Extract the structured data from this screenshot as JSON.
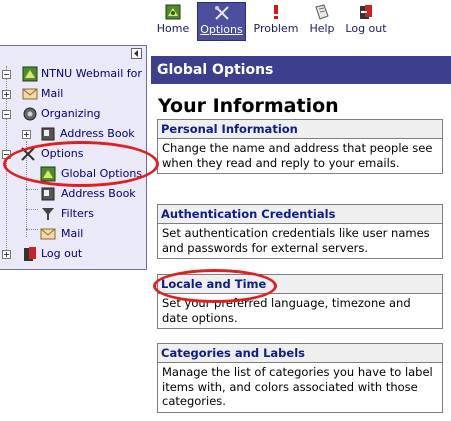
{
  "toolbar": {
    "items": [
      {
        "label": "Home",
        "icon": "home-icon"
      },
      {
        "label": "Options",
        "icon": "options-icon",
        "active": true
      },
      {
        "label": "Problem",
        "icon": "problem-icon"
      },
      {
        "label": "Help",
        "icon": "help-icon"
      },
      {
        "label": "Log out",
        "icon": "logout-icon"
      }
    ]
  },
  "sidebar": {
    "items": [
      {
        "label": "NTNU Webmail for",
        "icon": "webmail-icon"
      },
      {
        "label": "Mail",
        "icon": "mail-icon"
      },
      {
        "label": "Organizing",
        "icon": "organizing-icon"
      },
      {
        "label": "Address Book",
        "icon": "address-book-icon"
      },
      {
        "label": "Options",
        "icon": "options-icon"
      },
      {
        "label": "Global Options",
        "icon": "global-options-icon"
      },
      {
        "label": "Address Book",
        "icon": "address-book-icon"
      },
      {
        "label": "Filters",
        "icon": "filters-icon"
      },
      {
        "label": "Mail",
        "icon": "mail-icon"
      },
      {
        "label": "Log out",
        "icon": "logout-icon"
      }
    ]
  },
  "main": {
    "banner": "Global Options",
    "section_title": "Your Information",
    "cards": [
      {
        "title": "Personal Information",
        "desc": "Change the name and address that people see when they read and reply to your emails."
      },
      {
        "title": "Authentication Credentials",
        "desc": "Set authentication credentials like user names and passwords for external servers."
      },
      {
        "title": "Locale and Time",
        "desc": "Set your preferred language, timezone and date options."
      },
      {
        "title": "Categories and Labels",
        "desc": "Manage the list of categories you have to label items with, and colors associated with those categories."
      }
    ]
  },
  "colors": {
    "banner_bg": "#3b3f8e",
    "sidebar_bg": "#e9e9f8",
    "link": "#0b1e8a",
    "annotation": "#e02020"
  }
}
